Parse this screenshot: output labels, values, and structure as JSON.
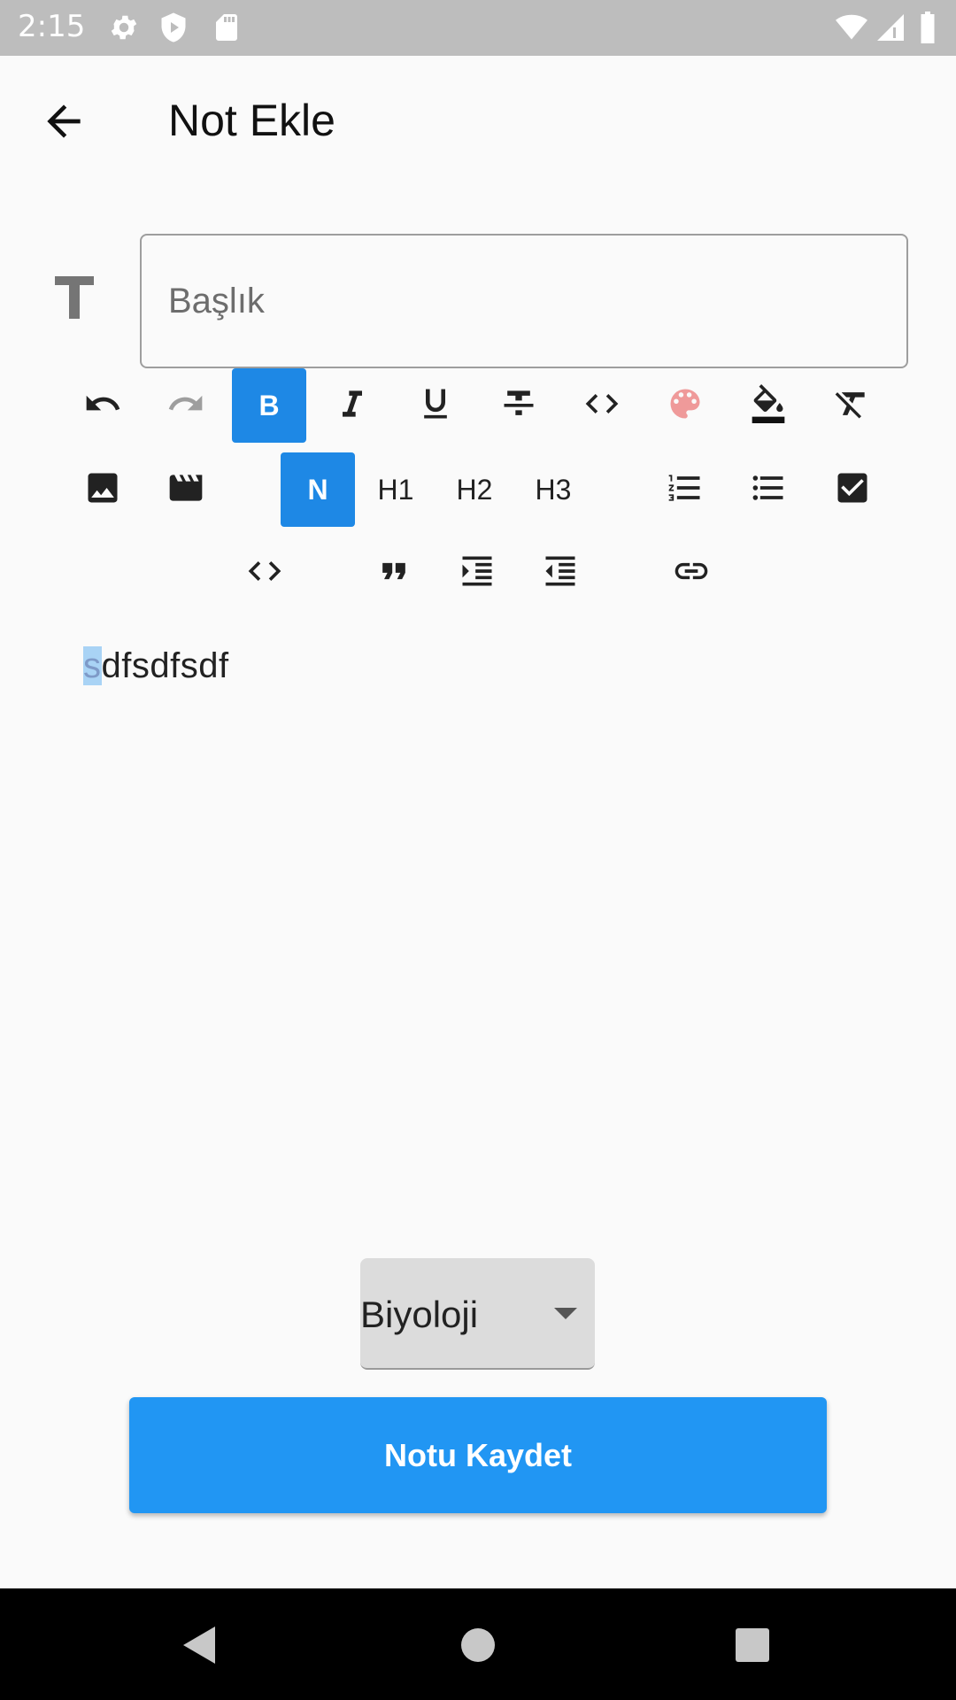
{
  "status_bar": {
    "time": "2:15",
    "icons": [
      "settings-icon",
      "shield-icon",
      "sd-card-icon",
      "wifi-icon",
      "cell-signal-icon",
      "battery-icon"
    ]
  },
  "app_bar": {
    "back_icon": "arrow-back-icon",
    "title": "Not Ekle"
  },
  "title_field": {
    "icon": "text-t-icon",
    "placeholder": "Başlık",
    "value": ""
  },
  "toolbar": {
    "row1": [
      {
        "name": "undo",
        "icon": "undo-icon"
      },
      {
        "name": "redo",
        "icon": "redo-icon"
      },
      {
        "name": "bold",
        "label": "B",
        "active": true
      },
      {
        "name": "italic",
        "icon": "italic-icon"
      },
      {
        "name": "underline",
        "icon": "underline-icon"
      },
      {
        "name": "strikethrough",
        "icon": "strikethrough-icon"
      },
      {
        "name": "inline-code",
        "icon": "code-icon"
      },
      {
        "name": "text-color",
        "icon": "palette-icon"
      },
      {
        "name": "background-color",
        "icon": "fill-color-icon"
      },
      {
        "name": "clear-format",
        "icon": "format-clear-icon"
      }
    ],
    "row2": [
      {
        "name": "image",
        "icon": "image-icon"
      },
      {
        "name": "video",
        "icon": "movie-icon"
      },
      {
        "name": "normal",
        "label": "N",
        "active": true
      },
      {
        "name": "h1",
        "label": "H1"
      },
      {
        "name": "h2",
        "label": "H2"
      },
      {
        "name": "h3",
        "label": "H3"
      },
      {
        "name": "numbered-list",
        "icon": "numbered-list-icon"
      },
      {
        "name": "bullet-list",
        "icon": "bullet-list-icon"
      },
      {
        "name": "checklist",
        "icon": "checkbox-icon"
      }
    ],
    "row3": [
      {
        "name": "code-block",
        "icon": "code-icon"
      },
      {
        "name": "quote",
        "icon": "quote-icon"
      },
      {
        "name": "indent",
        "icon": "indent-icon"
      },
      {
        "name": "outdent",
        "icon": "outdent-icon"
      },
      {
        "name": "link",
        "icon": "link-icon"
      }
    ]
  },
  "colors": {
    "accent": "#2196f3",
    "active_toolbar": "#1e88e5",
    "palette_icon": "#ef9a9a",
    "selection": "#a9d3f5"
  },
  "editor": {
    "first_char": "s",
    "rest": "dfsdfsdf"
  },
  "category_dropdown": {
    "selected": "Biyoloji"
  },
  "save_button": {
    "label": "Notu Kaydet"
  },
  "nav_bar": {
    "icons": [
      "back-triangle-icon",
      "home-circle-icon",
      "recents-square-icon"
    ]
  }
}
